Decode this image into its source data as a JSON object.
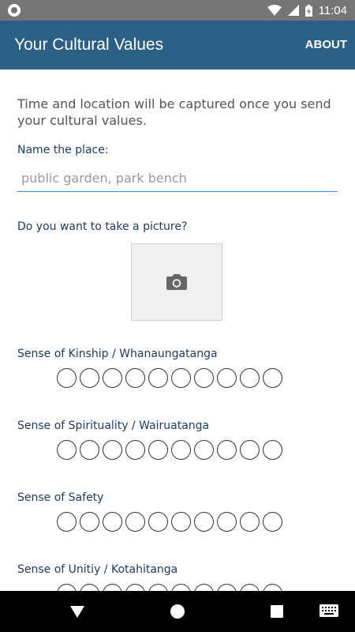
{
  "status_bar": {
    "time": "11:04",
    "icons": [
      "notification-dot-icon",
      "wifi-icon",
      "cellular-signal-icon",
      "battery-charging-icon"
    ]
  },
  "app_bar": {
    "title": "Your Cultural Values",
    "about_label": "ABOUT",
    "color": "#2c5f85"
  },
  "form": {
    "intro": "Time and location will be captured once you send your cultural values.",
    "place_label": "Name the place:",
    "place_placeholder": "public garden, park bench",
    "place_value": "",
    "picture_label": "Do you want to take a picture?",
    "picture_icon": "camera-icon",
    "values": [
      {
        "label": "Sense of Kinship / Whanaungatanga",
        "scale_points": 10,
        "selected": null
      },
      {
        "label": "Sense of Spirituality / Wairuatanga",
        "scale_points": 10,
        "selected": null
      },
      {
        "label": "Sense of Safety",
        "scale_points": 10,
        "selected": null
      },
      {
        "label": "Sense of Unitiy / Kotahitanga",
        "scale_points": 10,
        "selected": null
      }
    ]
  },
  "nav_bar": {
    "icons": [
      "back-icon",
      "home-icon",
      "recents-icon",
      "keyboard-icon"
    ]
  }
}
